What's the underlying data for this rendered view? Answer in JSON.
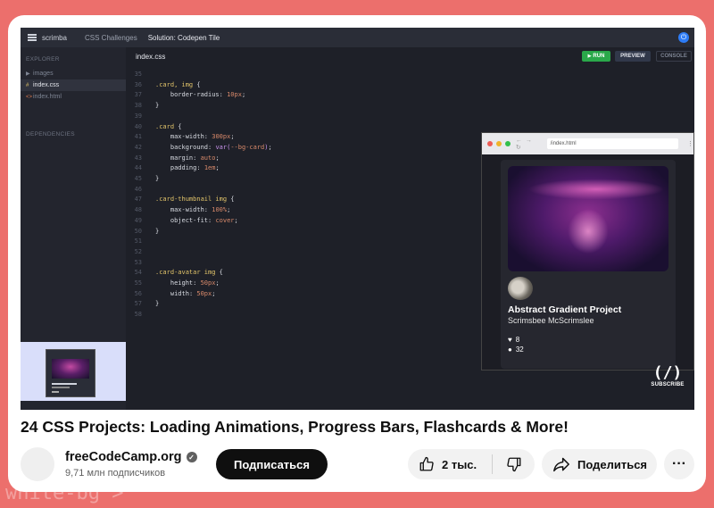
{
  "background": {
    "text": "white-bg\">",
    "accent": "#ec6f6c"
  },
  "video": {
    "app": {
      "logo": "scrimba",
      "breadcrumb": [
        "CSS Challenges",
        "Solution: Codepen Tile"
      ]
    },
    "sidebar": {
      "explorer_header": "EXPLORER",
      "files": [
        {
          "icon": "folder-icon",
          "name": "images",
          "active": false
        },
        {
          "icon": "hash-icon",
          "name": "index.css",
          "active": true
        },
        {
          "icon": "html-icon",
          "name": "index.html",
          "active": false
        }
      ],
      "dependencies_header": "DEPENDENCIES"
    },
    "editor": {
      "filename": "index.css",
      "buttons": {
        "run": "RUN",
        "preview": "PREVIEW",
        "console": "CONSOLE"
      },
      "lines": [
        {
          "n": "35",
          "code": ""
        },
        {
          "n": "36",
          "code": ".card, img {"
        },
        {
          "n": "37",
          "code": "    border-radius: 10px;"
        },
        {
          "n": "38",
          "code": "}"
        },
        {
          "n": "39",
          "code": ""
        },
        {
          "n": "40",
          "code": ".card {"
        },
        {
          "n": "41",
          "code": "    max-width: 300px;"
        },
        {
          "n": "42",
          "code": "    background: var(--bg-card);"
        },
        {
          "n": "43",
          "code": "    margin: auto;"
        },
        {
          "n": "44",
          "code": "    padding: 1em;"
        },
        {
          "n": "45",
          "code": "}"
        },
        {
          "n": "46",
          "code": ""
        },
        {
          "n": "47",
          "code": ".card-thumbnail img {"
        },
        {
          "n": "48",
          "code": "    max-width: 100%;"
        },
        {
          "n": "49",
          "code": "    object-fit: cover;"
        },
        {
          "n": "50",
          "code": "}"
        },
        {
          "n": "51",
          "code": ""
        },
        {
          "n": "52",
          "code": ""
        },
        {
          "n": "53",
          "code": ""
        },
        {
          "n": "54",
          "code": ".card-avatar img {"
        },
        {
          "n": "55",
          "code": "    height: 50px;"
        },
        {
          "n": "56",
          "code": "    width: 50px;"
        },
        {
          "n": "57",
          "code": "}"
        },
        {
          "n": "58",
          "code": ""
        }
      ]
    },
    "preview": {
      "url": "/index.html",
      "card": {
        "title": "Abstract Gradient Project",
        "author": "Scrimsbee McScrimslee",
        "likes": "8",
        "comments": "32"
      }
    },
    "channel_badge": {
      "logo": "(/'̶)",
      "label": "SUBSCRIBE"
    }
  },
  "video_title": "24 CSS Projects: Loading Animations, Progress Bars, Flashcards & More!",
  "channel": {
    "name": "freeCodeCamp.org",
    "subscribers": "9,71 млн подписчиков"
  },
  "actions": {
    "subscribe": "Подписаться",
    "likes": "2 тыс.",
    "share": "Поделиться",
    "more": "···"
  }
}
